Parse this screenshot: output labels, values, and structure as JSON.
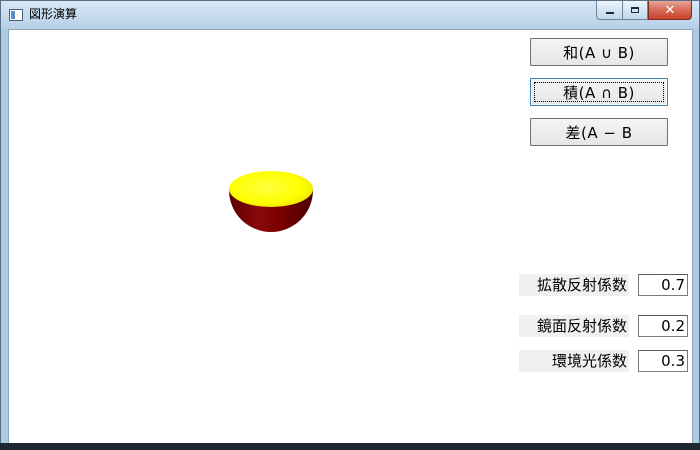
{
  "window": {
    "title": "図形演算",
    "icons": {
      "app": "window-app-icon",
      "minimize": "minimize-icon",
      "maximize": "maximize-icon",
      "close": "close-icon"
    },
    "close_glyph": "✕"
  },
  "buttons": {
    "union": "和(A ∪ B)",
    "intersection": "積(A ∩ B)",
    "difference": "差(A − B"
  },
  "params": {
    "diffuse": {
      "label": "拡散反射係数",
      "value": "0.7"
    },
    "specular": {
      "label": "鏡面反射係数",
      "value": "0.2"
    },
    "ambient": {
      "label": "環境光係数",
      "value": "0.3"
    }
  },
  "scene": {
    "object": "hemisphere-bowl",
    "top_color": "#ffff00",
    "side_color": "#7a0000",
    "background": "#ffffff"
  }
}
